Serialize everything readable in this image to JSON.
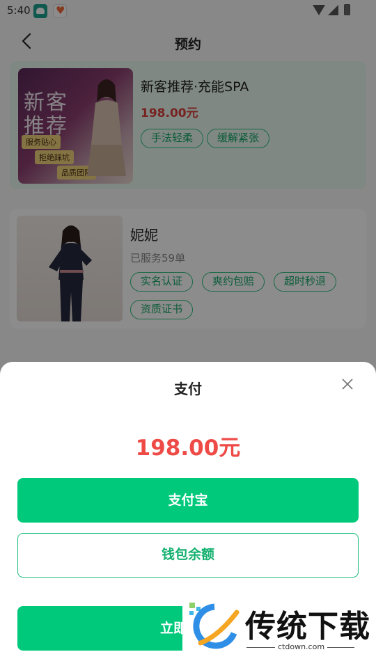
{
  "status_bar": {
    "time": "5:40"
  },
  "header": {
    "title": "预约",
    "back_icon": "chevron-left-icon"
  },
  "service": {
    "title": "新客推荐·充能SPA",
    "price": "198.00元",
    "tags": [
      "手法轻柔",
      "缓解紧张"
    ],
    "image": {
      "headline_1": "新客",
      "headline_2": "推荐",
      "ribbons": [
        "服务贴心",
        "拒绝踩坑",
        "品质团队"
      ]
    }
  },
  "therapist": {
    "name": "妮妮",
    "served": "已服务59单",
    "tags": [
      "实名认证",
      "爽约包赔",
      "超时秒退",
      "资质证书"
    ]
  },
  "payment": {
    "title": "支付",
    "amount": "198.00元",
    "alipay_label": "支付宝",
    "wallet_label": "钱包余额",
    "pay_now_label": "立即",
    "close_icon": "close-icon"
  },
  "watermark": {
    "brand": "传统下载",
    "url": "ctdown.com"
  },
  "colors": {
    "accent": "#00c97c",
    "price": "#ee4b47",
    "tag": "#17a86a",
    "card_tint": "#e7f7ef"
  }
}
